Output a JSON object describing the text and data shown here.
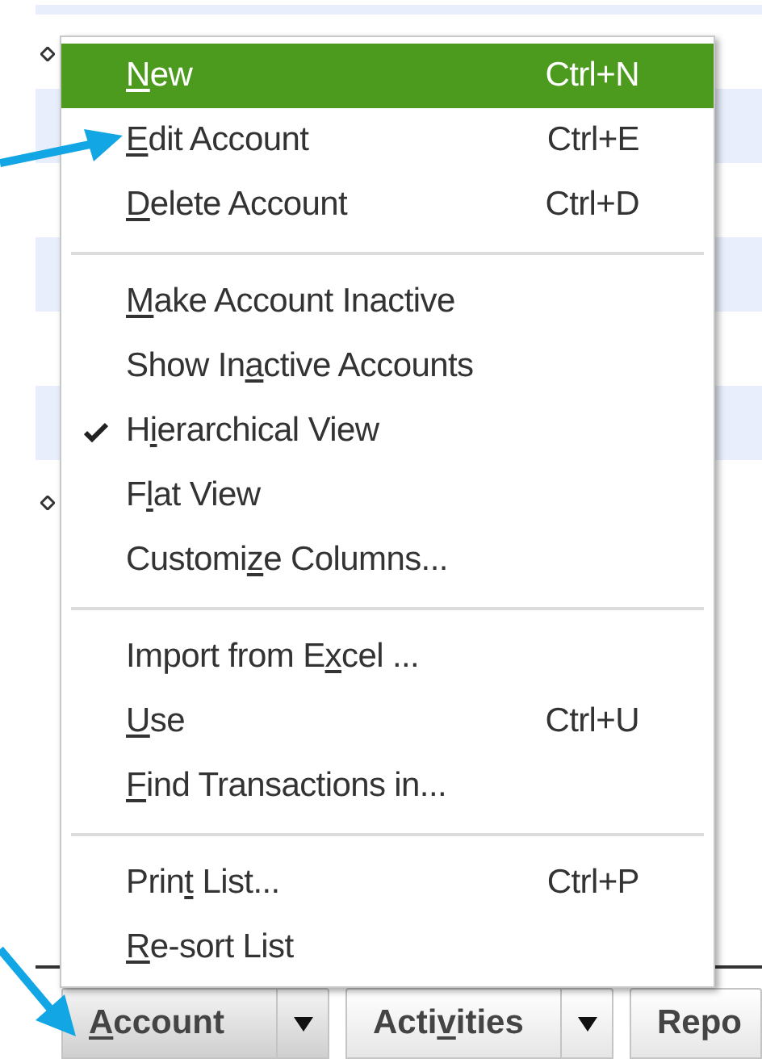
{
  "menu": {
    "items": [
      {
        "kind": "item",
        "label": {
          "key": "N",
          "post": "ew"
        },
        "shortcut": "Ctrl+N",
        "selected": true,
        "checked": false
      },
      {
        "kind": "item",
        "label": {
          "key": "E",
          "post": "dit Account"
        },
        "shortcut": "Ctrl+E",
        "selected": false,
        "checked": false
      },
      {
        "kind": "item",
        "label": {
          "key": "D",
          "post": "elete Account"
        },
        "shortcut": "Ctrl+D",
        "selected": false,
        "checked": false
      },
      {
        "kind": "separator"
      },
      {
        "kind": "item",
        "label": {
          "key": "M",
          "post": "ake Account Inactive"
        },
        "selected": false,
        "checked": false
      },
      {
        "kind": "item",
        "label": {
          "pre": "Show In",
          "key": "a",
          "post": "ctive Accounts"
        },
        "selected": false,
        "checked": false
      },
      {
        "kind": "item",
        "label": {
          "pre": "H",
          "key": "i",
          "post": "erarchical View"
        },
        "selected": false,
        "checked": true
      },
      {
        "kind": "item",
        "label": {
          "pre": "F",
          "key": "l",
          "post": "at View"
        },
        "selected": false,
        "checked": false
      },
      {
        "kind": "item",
        "label": {
          "pre": "Customi",
          "key": "z",
          "post": "e Columns..."
        },
        "selected": false,
        "checked": false
      },
      {
        "kind": "separator"
      },
      {
        "kind": "item",
        "label": {
          "pre": "Import from E",
          "key": "x",
          "post": "cel ..."
        },
        "selected": false,
        "checked": false
      },
      {
        "kind": "item",
        "label": {
          "key": "U",
          "post": "se"
        },
        "shortcut": "Ctrl+U",
        "selected": false,
        "checked": false
      },
      {
        "kind": "item",
        "label": {
          "key": "F",
          "post": "ind Transactions in..."
        },
        "selected": false,
        "checked": false
      },
      {
        "kind": "separator"
      },
      {
        "kind": "item",
        "label": {
          "pre": "Prin",
          "key": "t",
          "post": " List..."
        },
        "shortcut": "Ctrl+P",
        "selected": false,
        "checked": false
      },
      {
        "kind": "item",
        "label": {
          "key": "R",
          "post": "e-sort List"
        },
        "selected": false,
        "checked": false
      }
    ]
  },
  "bottom_buttons": [
    {
      "label": {
        "key": "A",
        "post": "ccount"
      },
      "dropdown": true,
      "selected": true
    },
    {
      "label": {
        "pre": "Acti",
        "key": "v",
        "post": "ities"
      },
      "dropdown": true,
      "selected": false
    },
    {
      "label": {
        "pre": "Repo"
      },
      "dropdown": false,
      "selected": false
    }
  ]
}
